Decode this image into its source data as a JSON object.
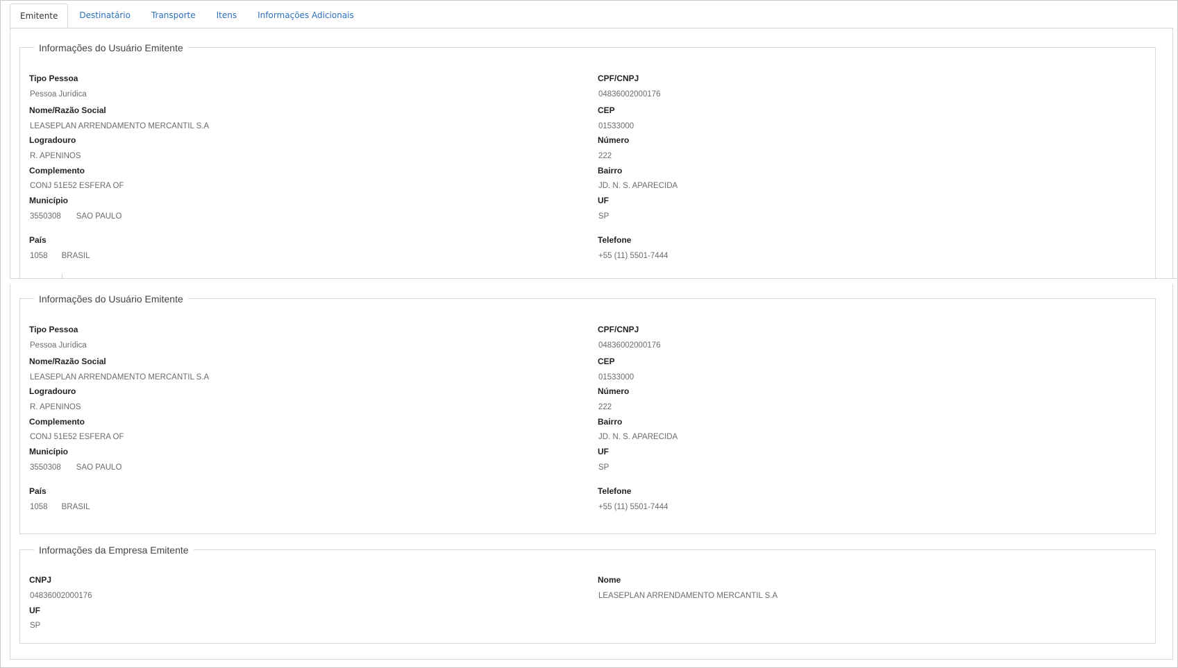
{
  "tabs": [
    {
      "label": "Emitente",
      "active": true
    },
    {
      "label": "Destinatário",
      "active": false
    },
    {
      "label": "Transporte",
      "active": false
    },
    {
      "label": "Itens",
      "active": false
    },
    {
      "label": "Informações Adicionais",
      "active": false
    }
  ],
  "usuario_1": {
    "title": "Informações do Usuário Emitente",
    "tipo_pessoa_label": "Tipo Pessoa",
    "tipo_pessoa": "Pessoa Jurídica",
    "cpf_label": "CPF/CNPJ",
    "cpf": "04836002000176",
    "nome_label": "Nome/Razão Social",
    "nome": "LEASEPLAN ARRENDAMENTO MERCANTIL S.A",
    "cep_label": "CEP",
    "cep": "01533000",
    "logradouro_label": "Logradouro",
    "logradouro": "R. APENINOS",
    "numero_label": "Número",
    "numero": "222",
    "complemento_label": "Complemento",
    "complemento": "CONJ 51E52 ESFERA OF",
    "bairro_label": "Bairro",
    "bairro": "JD. N. S. APARECIDA",
    "municipio_label": "Município",
    "municipio_code": "3550308",
    "municipio_name": "SAO PAULO",
    "uf_label": "UF",
    "uf": "SP",
    "pais_label": "País",
    "pais_code": "1058",
    "pais_name": "BRASIL",
    "telefone_label": "Telefone",
    "telefone": "+55 (11) 5501-7444"
  },
  "usuario_2": {
    "title": "Informações do Usuário Emitente",
    "tipo_pessoa_label": "Tipo Pessoa",
    "tipo_pessoa": "Pessoa Jurídica",
    "cpf_label": "CPF/CNPJ",
    "cpf": "04836002000176",
    "nome_label": "Nome/Razão Social",
    "nome": "LEASEPLAN ARRENDAMENTO MERCANTIL S.A",
    "cep_label": "CEP",
    "cep": "01533000",
    "logradouro_label": "Logradouro",
    "logradouro": "R. APENINOS",
    "numero_label": "Número",
    "numero": "222",
    "complemento_label": "Complemento",
    "complemento": "CONJ 51E52 ESFERA OF",
    "bairro_label": "Bairro",
    "bairro": "JD. N. S. APARECIDA",
    "municipio_label": "Município",
    "municipio_code": "3550308",
    "municipio_name": "SAO PAULO",
    "uf_label": "UF",
    "uf": "SP",
    "pais_label": "País",
    "pais_code": "1058",
    "pais_name": "BRASIL",
    "telefone_label": "Telefone",
    "telefone": "+55 (11) 5501-7444"
  },
  "empresa": {
    "title": "Informações da Empresa Emitente",
    "cnpj_label": "CNPJ",
    "cnpj": "04836002000176",
    "nome_label": "Nome",
    "nome": "LEASEPLAN ARRENDAMENTO MERCANTIL S.A",
    "uf_label": "UF",
    "uf": "SP"
  }
}
